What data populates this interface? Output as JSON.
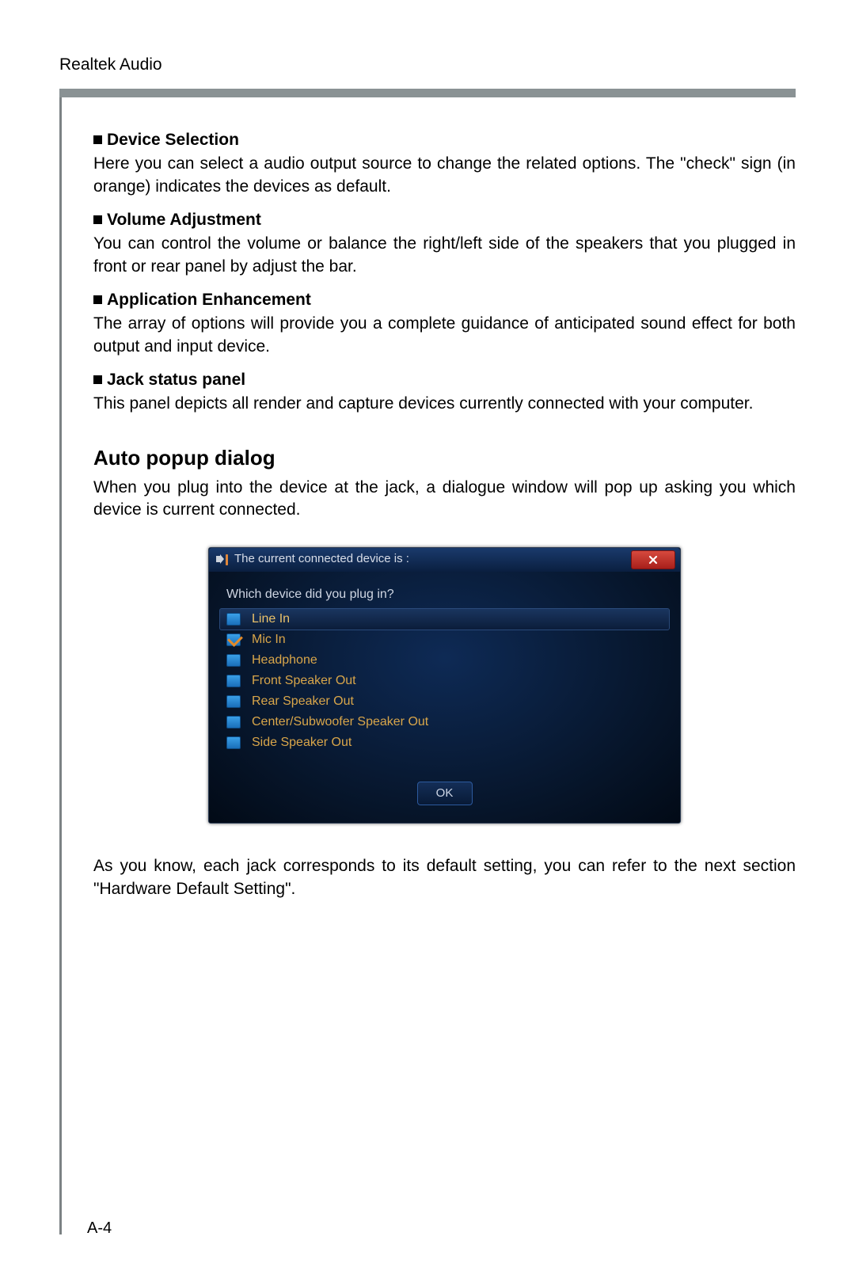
{
  "running_head": "Realtek Audio",
  "sections": [
    {
      "title": "Device Selection",
      "body": "Here you can select a audio output source to change the related options. The \"check\" sign (in orange) indicates the devices as default."
    },
    {
      "title": "Volume Adjustment",
      "body": "You can control the volume or balance the right/left side of the speakers that you plugged in front or rear panel by adjust the bar."
    },
    {
      "title": "Application Enhancement",
      "body": "The array of options will provide you a complete guidance of anticipated sound effect for both output and input device."
    },
    {
      "title": "Jack status panel",
      "body": "This panel depicts all render and capture devices currently connected with your computer."
    }
  ],
  "auto_popup": {
    "heading": "Auto popup dialog",
    "intro": "When you plug into the device at the jack, a dialogue window will pop up asking you which device is current connected.",
    "outro": "As you know, each jack corresponds to its default setting, you can refer to the next section \"Hardware Default Setting\"."
  },
  "dialog": {
    "title": "The current connected device is :",
    "prompt": "Which device did you plug in?",
    "options": [
      {
        "label": "Line In",
        "checked": false,
        "highlighted": true
      },
      {
        "label": "Mic In",
        "checked": true,
        "highlighted": false
      },
      {
        "label": "Headphone",
        "checked": false,
        "highlighted": false
      },
      {
        "label": "Front Speaker Out",
        "checked": false,
        "highlighted": false
      },
      {
        "label": "Rear Speaker Out",
        "checked": false,
        "highlighted": false
      },
      {
        "label": "Center/Subwoofer Speaker Out",
        "checked": false,
        "highlighted": false
      },
      {
        "label": "Side Speaker Out",
        "checked": false,
        "highlighted": false
      }
    ],
    "ok": "OK"
  },
  "page_number": "A-4"
}
